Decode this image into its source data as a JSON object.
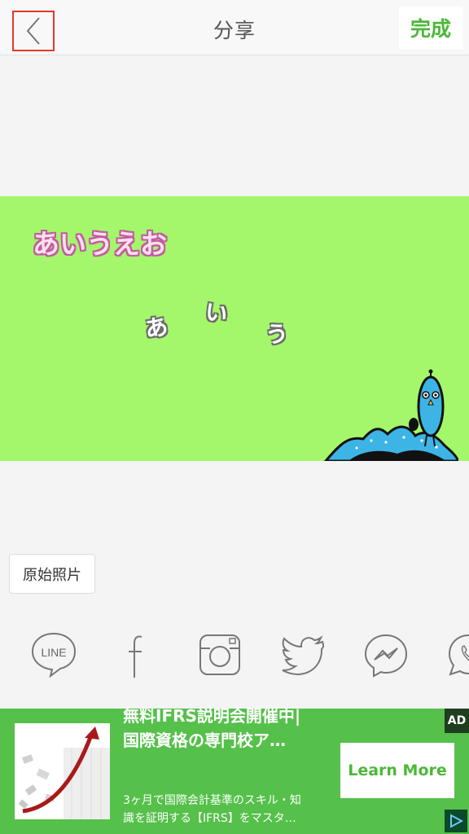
{
  "header": {
    "title": "分享",
    "done_label": "完成",
    "back_icon": "chevron-left-icon"
  },
  "canvas": {
    "background": "#a4f76a",
    "big_text": "あいうえお",
    "small_chars": [
      "あ",
      "い",
      "う"
    ]
  },
  "original_photo_label": "原始照片",
  "share_targets": [
    {
      "name": "LINE",
      "icon": "line-icon",
      "label": "LINE"
    },
    {
      "name": "Facebook",
      "icon": "facebook-icon"
    },
    {
      "name": "Instagram",
      "icon": "instagram-icon"
    },
    {
      "name": "Twitter",
      "icon": "twitter-icon"
    },
    {
      "name": "Messenger",
      "icon": "messenger-icon"
    },
    {
      "name": "WhatsApp",
      "icon": "whatsapp-icon"
    }
  ],
  "ad": {
    "headline": "無料IFRS説明会開催中|\n国際資格の専門校ア…",
    "body": "3ヶ月で国際会計基準のスキル・知\n識を証明する【IFRS】をマスタ…",
    "cta": "Learn More",
    "badge": "AD",
    "background": "#55c04a"
  }
}
